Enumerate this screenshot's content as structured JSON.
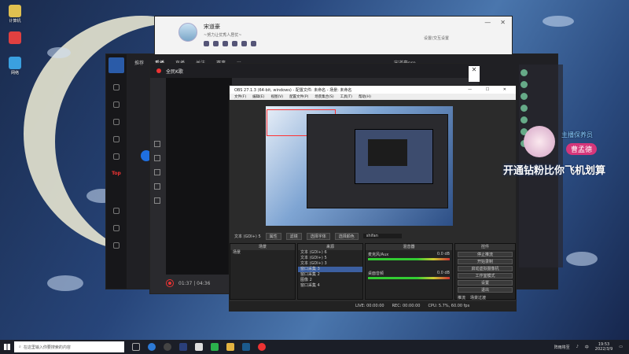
{
  "desktop": {
    "icons": [
      {
        "label": "计算机",
        "color": "#e0c050"
      },
      {
        "label": "",
        "color": "#e04040"
      },
      {
        "label": "网络",
        "color": "#3aa0e0"
      }
    ]
  },
  "qq": {
    "name": "宋道豪",
    "signature": "~努力让优秀人居优~",
    "settings": "设置(交互设置",
    "min": "—",
    "close": "✕"
  },
  "left_app": {
    "tabs": [
      "推荐",
      "看播",
      "直播",
      "关注",
      "赛事"
    ],
    "more": "···",
    "user": "宋道豪pro",
    "top_label": "Top"
  },
  "player": {
    "title": "全民K歌",
    "time": "01:37 | 04:36"
  },
  "obs": {
    "title": "OBS 27.1.3 (64-bit, windows) - 配置文件: 未命名 - 场景: 未命名",
    "menu": [
      "文件(F)",
      "编辑(E)",
      "视图(V)",
      "配置文件(P)",
      "场景集合(S)",
      "工具(T)",
      "帮助(H)"
    ],
    "toolbar": {
      "source_label": "文本 (GDI+) 5",
      "properties": "属性",
      "filters": "滤镜",
      "select_font": "选择字体",
      "select_color": "选择颜色",
      "text_value": "shifan"
    },
    "docks": {
      "scenes": "场景",
      "sources": "来源",
      "mixer": "混音器",
      "controls": "控件"
    },
    "scenes": [
      "场景"
    ],
    "sources": [
      "文本 (GDI+) 6",
      "文本 (GDI+) 5",
      "文本 (GDI+) 3",
      "窗口采集 3",
      "窗口采集 2",
      "图像 2",
      "窗口采集 4"
    ],
    "mixer": [
      {
        "name": "麦克风/Aux",
        "db": "0.0 dB"
      },
      {
        "name": "桌面音频",
        "db": "0.0 dB"
      }
    ],
    "controls": [
      "停止推流",
      "开始录制",
      "启动虚拟摄像机",
      "工作室模式",
      "设置",
      "退出"
    ],
    "bottom_controls": [
      "推流",
      "场景过渡"
    ],
    "status": {
      "live": "LIVE: 00:00:00",
      "rec": "REC: 00:00:00",
      "cpu": "CPU: 5.7%, 60.00 fps"
    }
  },
  "overlay": {
    "tag_top": "主播保养员",
    "tag_name": "曹孟德",
    "banner": "开通钻粉比你飞机划算"
  },
  "taskbar": {
    "search_placeholder": "在这里输入你要搜索的内容",
    "weather": "阵雨将至",
    "time": "19:53",
    "date": "2022/3/9",
    "lang": "中"
  }
}
